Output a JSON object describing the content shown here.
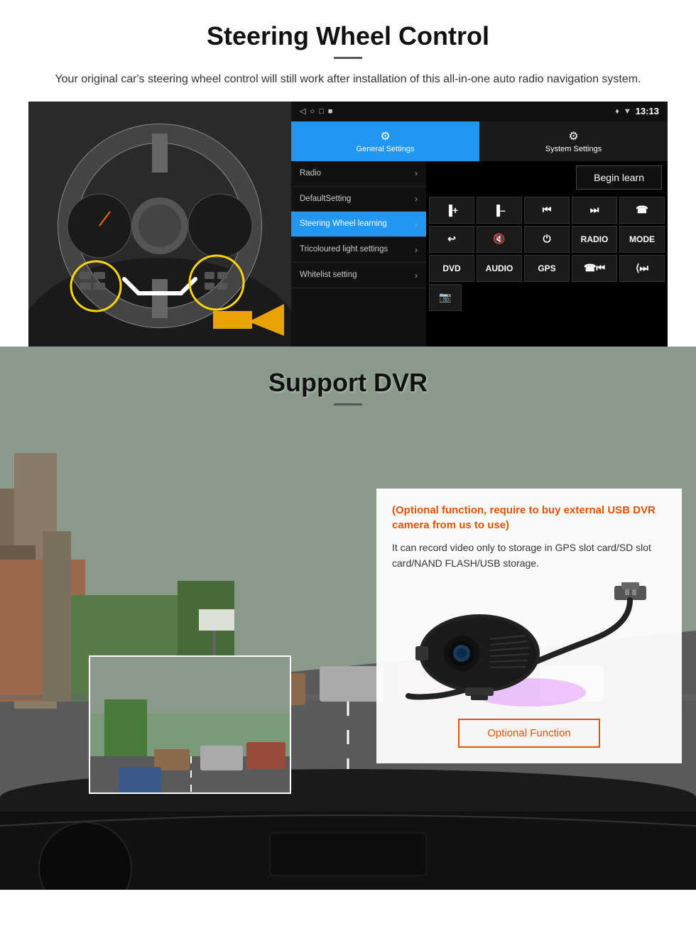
{
  "steering": {
    "title": "Steering Wheel Control",
    "subtitle": "Your original car's steering wheel control will still work after installation of this all-in-one auto radio navigation system.",
    "statusbar": {
      "time": "13:13",
      "icons": [
        "◁",
        "○",
        "□",
        "■"
      ]
    },
    "tabs": {
      "general": "General Settings",
      "system": "System Settings"
    },
    "menu": [
      {
        "label": "Radio",
        "active": false
      },
      {
        "label": "DefaultSetting",
        "active": false
      },
      {
        "label": "Steering Wheel learning",
        "active": true
      },
      {
        "label": "Tricoloured light settings",
        "active": false
      },
      {
        "label": "Whitelist setting",
        "active": false
      }
    ],
    "begin_learn": "Begin learn",
    "controls": [
      [
        "▐+",
        "▐-",
        "◀◀",
        "▶▶",
        "☎"
      ],
      [
        "↩",
        "🔇",
        "⏻",
        "RADIO",
        "MODE"
      ],
      [
        "DVD",
        "AUDIO",
        "GPS",
        "☎◀◀",
        "⟨▶▶"
      ]
    ],
    "dvr_icon": "📷"
  },
  "dvr": {
    "title": "Support DVR",
    "optional_text": "(Optional function, require to buy external USB DVR camera from us to use)",
    "description": "It can record video only to storage in GPS slot card/SD slot card/NAND FLASH/USB storage.",
    "optional_btn": "Optional Function"
  }
}
